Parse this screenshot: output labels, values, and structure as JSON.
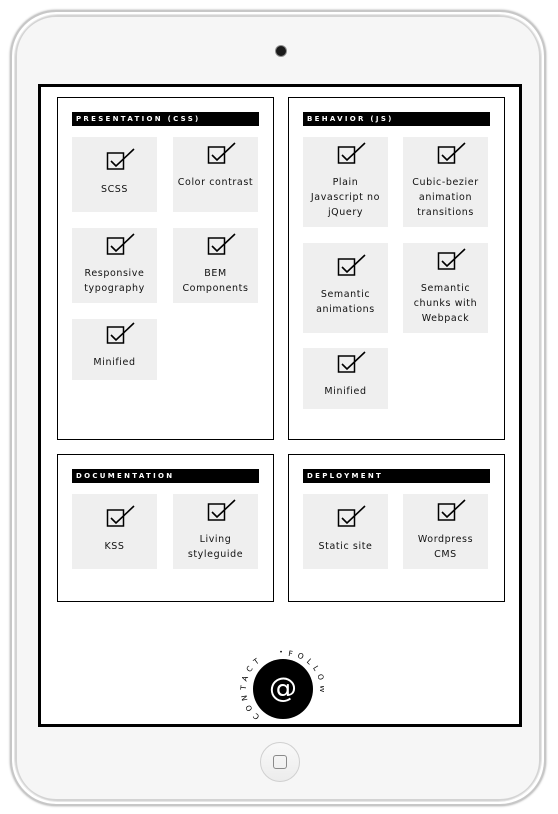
{
  "panels": [
    {
      "title": "PRESENTATION (CSS)",
      "tiles": [
        "SCSS",
        "Color contrast",
        "Responsive typography",
        "BEM Components",
        "Minified"
      ]
    },
    {
      "title": "BEHAVIOR (JS)",
      "tiles": [
        "Plain Javascript no jQuery",
        "Cubic-bezier animation transitions",
        "Semantic animations",
        "Semantic chunks with Webpack",
        "Minified"
      ]
    },
    {
      "title": "DOCUMENTATION",
      "tiles": [
        "KSS",
        "Living styleguide"
      ]
    },
    {
      "title": "DEPLOYMENT",
      "tiles": [
        "Static site",
        "Wordpress CMS"
      ]
    }
  ],
  "contact": {
    "symbol": "@",
    "ring_text_left": "CONTACT",
    "separator": "•",
    "ring_text_right": "FOLLOW"
  },
  "icons": {
    "tile_icon": "checkbox-checked-icon",
    "camera": "front-camera-icon",
    "home": "home-button-icon"
  },
  "colors": {
    "frame": "#f6f6f6",
    "screen": "#ffffff",
    "tile": "#efefef",
    "ink": "#000000"
  }
}
